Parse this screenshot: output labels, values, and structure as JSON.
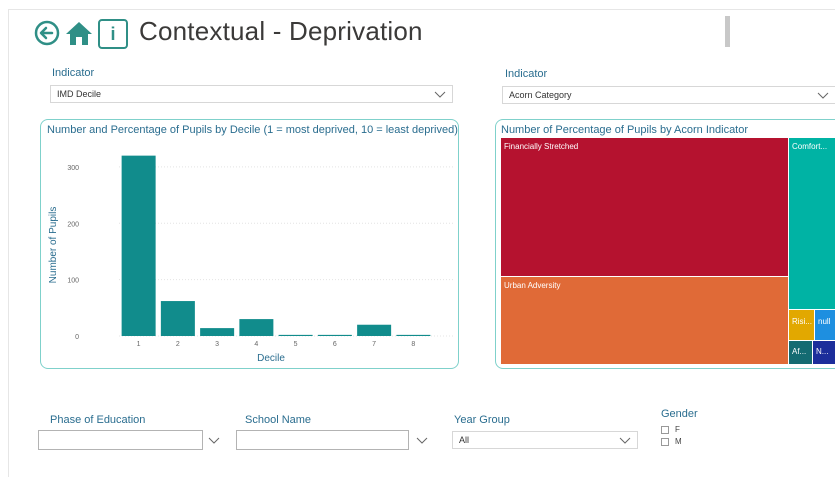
{
  "header": {
    "title": "Contextual - Deprivation",
    "info_label": "i",
    "icons": [
      "back-arrow-icon",
      "home-icon",
      "info-icon"
    ],
    "accent_color": "#2f8f86"
  },
  "slicers": {
    "left": {
      "label": "Indicator",
      "value": "IMD Decile"
    },
    "right": {
      "label": "Indicator",
      "value": "Acorn Category"
    }
  },
  "bar_card": {
    "title": "Number and Percentage of Pupils by Decile (1 = most deprived, 10 = least deprived)"
  },
  "chart_data": {
    "type": "bar",
    "title": "Number and Percentage of Pupils by Decile (1 = most deprived, 10 = least deprived)",
    "xlabel": "Decile",
    "ylabel": "Number of Pupils",
    "categories": [
      "1",
      "2",
      "3",
      "4",
      "5",
      "6",
      "7",
      "8"
    ],
    "values": [
      320,
      62,
      14,
      30,
      2,
      2,
      20,
      2
    ],
    "yticks": [
      0,
      100,
      200,
      300
    ],
    "ylim": [
      0,
      330
    ],
    "bar_color": "#118c8c",
    "grid": true
  },
  "treemap": {
    "title": "Number of Percentage of Pupils by Acorn Indicator",
    "cells": [
      {
        "label": "Financially Stretched",
        "color": "#b5122f"
      },
      {
        "label": "Urban Adversity",
        "color": "#e06a37"
      },
      {
        "label": "Comfort...",
        "color": "#00b3a4"
      },
      {
        "label": "Risi...",
        "color": "#e2a800"
      },
      {
        "label": "null",
        "color": "#1e8fe0"
      },
      {
        "label": "Af...",
        "color": "#146b72"
      },
      {
        "label": "N...",
        "color": "#1c2e9b"
      }
    ]
  },
  "filters": {
    "phase": {
      "label": "Phase of Education",
      "value": ""
    },
    "school": {
      "label": "School Name",
      "value": ""
    },
    "year": {
      "label": "Year Group",
      "value": "All"
    },
    "gender": {
      "label": "Gender",
      "options": [
        "F",
        "M"
      ]
    }
  }
}
